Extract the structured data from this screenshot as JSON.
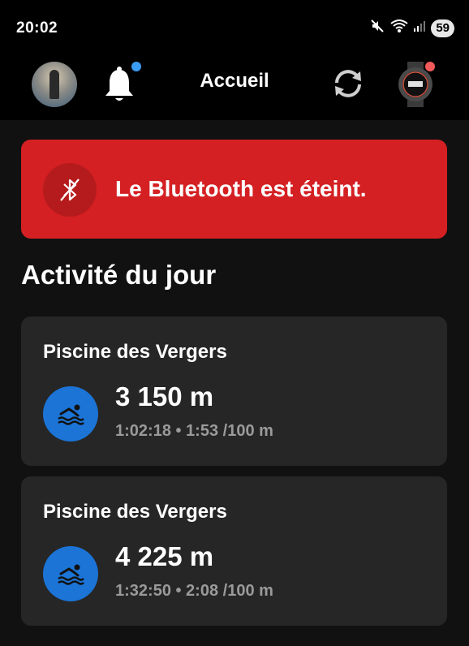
{
  "status": {
    "time": "20:02",
    "battery": "59"
  },
  "header": {
    "title": "Accueil",
    "notification_dot_color": "#3b9cf5",
    "device_dot_color": "#f25a5a"
  },
  "banner": {
    "text": "Le Bluetooth est éteint.",
    "color": "#d42023"
  },
  "section": {
    "title": "Activité du jour"
  },
  "activities": [
    {
      "title": "Piscine des Vergers",
      "distance": "3 150 m",
      "stats": "1:02:18 • 1:53 /100 m"
    },
    {
      "title": "Piscine des Vergers",
      "distance": "4 225 m",
      "stats": "1:32:50 • 2:08 /100 m"
    }
  ]
}
